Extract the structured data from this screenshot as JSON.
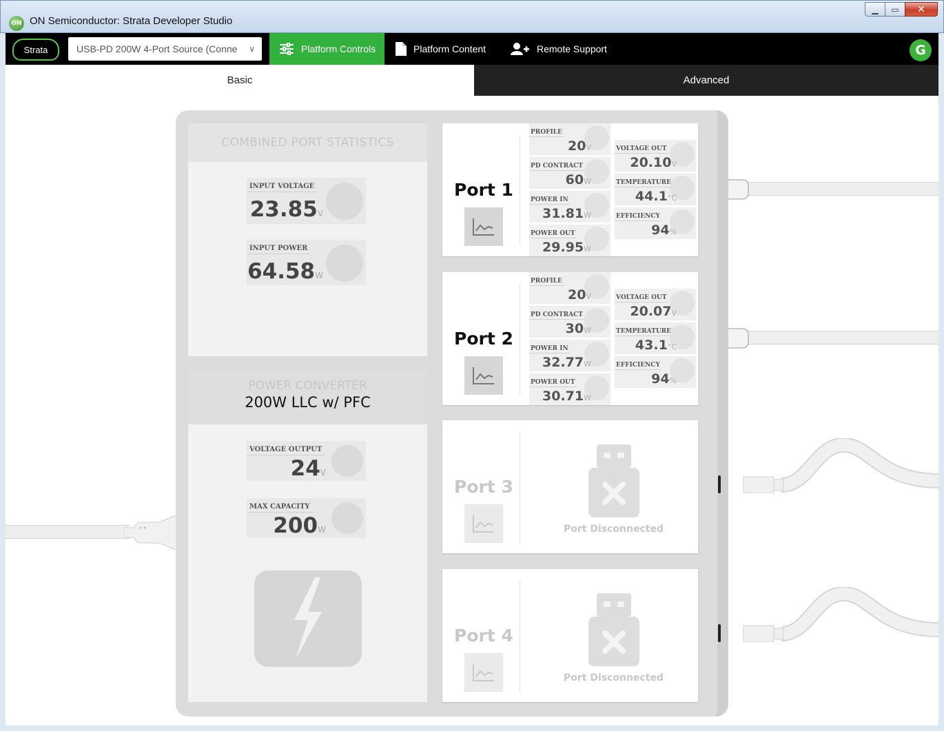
{
  "window": {
    "title": "ON Semiconductor: Strata Developer Studio",
    "app_icon_text": "ON"
  },
  "toolbar": {
    "logo_text": "Strata",
    "platform_select_value": "USB-PD 200W 4-Port Source (Conne",
    "nav": [
      {
        "label": "Platform Controls",
        "active": true,
        "icon": "sliders-icon"
      },
      {
        "label": "Platform Content",
        "active": false,
        "icon": "document-icon"
      },
      {
        "label": "Remote Support",
        "active": false,
        "icon": "add-user-icon"
      }
    ],
    "avatar_initial": "G"
  },
  "tabs": {
    "basic": "Basic",
    "advanced": "Advanced",
    "active": "basic"
  },
  "combined": {
    "header": "COMBINED PORT STATISTICS",
    "input_voltage": {
      "label": "INPUT VOLTAGE",
      "value": "23.85",
      "unit": "V"
    },
    "input_power": {
      "label": "INPUT POWER",
      "value": "64.58",
      "unit": "W"
    }
  },
  "converter": {
    "header": "POWER CONVERTER",
    "model": "200W LLC w/ PFC",
    "voltage_output": {
      "label": "VOLTAGE OUTPUT",
      "value": "24",
      "unit": "V"
    },
    "max_capacity": {
      "label": "MAX CAPACITY",
      "value": "200",
      "unit": "W"
    }
  },
  "ports": [
    {
      "name": "Port 1",
      "connected": true,
      "profile": {
        "label": "PROFILE",
        "value": "20",
        "unit": "V"
      },
      "pd_contract": {
        "label": "PD CONTRACT",
        "value": "60",
        "unit": "W"
      },
      "power_in": {
        "label": "POWER IN",
        "value": "31.81",
        "unit": "W"
      },
      "power_out": {
        "label": "POWER OUT",
        "value": "29.95",
        "unit": "W"
      },
      "voltage_out": {
        "label": "VOLTAGE OUT",
        "value": "20.10",
        "unit": "V"
      },
      "temperature": {
        "label": "TEMPERATURE",
        "value": "44.1",
        "unit": "°C"
      },
      "efficiency": {
        "label": "EFFICIENCY",
        "value": "94",
        "unit": "%"
      }
    },
    {
      "name": "Port 2",
      "connected": true,
      "profile": {
        "label": "PROFILE",
        "value": "20",
        "unit": "V"
      },
      "pd_contract": {
        "label": "PD CONTRACT",
        "value": "30",
        "unit": "W"
      },
      "power_in": {
        "label": "POWER IN",
        "value": "32.77",
        "unit": "W"
      },
      "power_out": {
        "label": "POWER OUT",
        "value": "30.71",
        "unit": "W"
      },
      "voltage_out": {
        "label": "VOLTAGE OUT",
        "value": "20.07",
        "unit": "V"
      },
      "temperature": {
        "label": "TEMPERATURE",
        "value": "43.1",
        "unit": "°C"
      },
      "efficiency": {
        "label": "EFFICIENCY",
        "value": "94",
        "unit": "%"
      }
    },
    {
      "name": "Port 3",
      "connected": false,
      "status": "Port Disconnected"
    },
    {
      "name": "Port 4",
      "connected": false,
      "status": "Port Disconnected"
    }
  ],
  "colors": {
    "accent_green": "#33b13d",
    "toolbar_bg": "#000000",
    "tab_dark": "#222222",
    "hub_gray": "#dcdcdc"
  }
}
